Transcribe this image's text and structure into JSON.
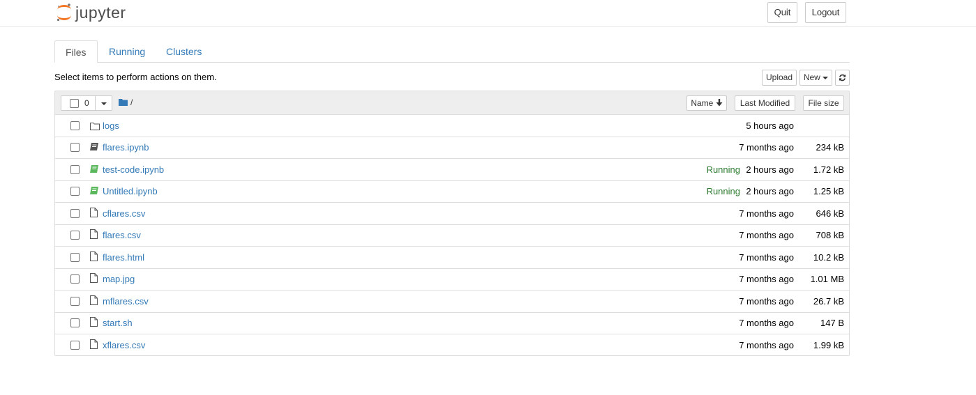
{
  "header": {
    "logo_text": "jupyter",
    "quit_label": "Quit",
    "logout_label": "Logout"
  },
  "tabs": [
    "Files",
    "Running",
    "Clusters"
  ],
  "toolbar": {
    "instructions": "Select items to perform actions on them.",
    "upload_label": "Upload",
    "new_label": "New",
    "refresh_icon": "refresh-icon"
  },
  "list_header": {
    "selected_count": "0",
    "breadcrumb": "/",
    "sort_name": "Name",
    "sort_modified": "Last Modified",
    "sort_size": "File size"
  },
  "colors": {
    "link": "#337ab7",
    "running": "#2e7d32",
    "logo_orange": "#f37726",
    "notebook_running": "#5cb85c"
  },
  "files": [
    {
      "name": "logs",
      "type": "folder",
      "running": "",
      "modified": "5 hours ago",
      "size": ""
    },
    {
      "name": "flares.ipynb",
      "type": "notebook",
      "running": "",
      "modified": "7 months ago",
      "size": "234 kB"
    },
    {
      "name": "test-code.ipynb",
      "type": "notebook-running",
      "running": "Running",
      "modified": "2 hours ago",
      "size": "1.72 kB"
    },
    {
      "name": "Untitled.ipynb",
      "type": "notebook-running",
      "running": "Running",
      "modified": "2 hours ago",
      "size": "1.25 kB"
    },
    {
      "name": "cflares.csv",
      "type": "file",
      "running": "",
      "modified": "7 months ago",
      "size": "646 kB"
    },
    {
      "name": "flares.csv",
      "type": "file",
      "running": "",
      "modified": "7 months ago",
      "size": "708 kB"
    },
    {
      "name": "flares.html",
      "type": "file",
      "running": "",
      "modified": "7 months ago",
      "size": "10.2 kB"
    },
    {
      "name": "map.jpg",
      "type": "file",
      "running": "",
      "modified": "7 months ago",
      "size": "1.01 MB"
    },
    {
      "name": "mflares.csv",
      "type": "file",
      "running": "",
      "modified": "7 months ago",
      "size": "26.7 kB"
    },
    {
      "name": "start.sh",
      "type": "file",
      "running": "",
      "modified": "7 months ago",
      "size": "147 B"
    },
    {
      "name": "xflares.csv",
      "type": "file",
      "running": "",
      "modified": "7 months ago",
      "size": "1.99 kB"
    }
  ]
}
